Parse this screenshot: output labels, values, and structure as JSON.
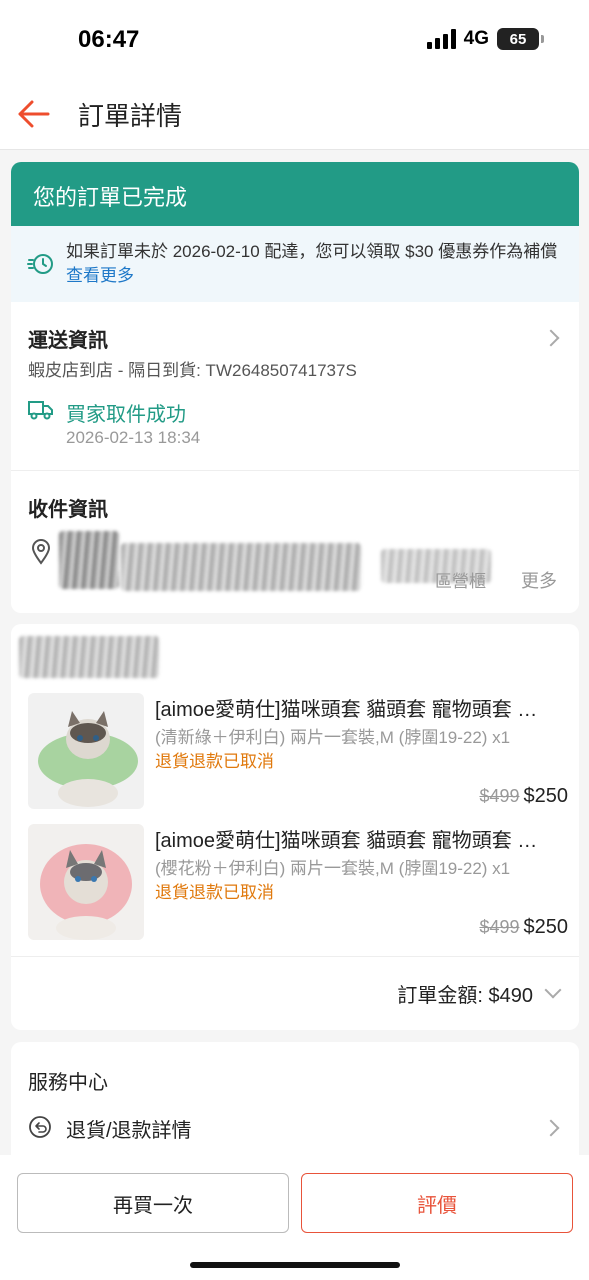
{
  "status_bar": {
    "time": "06:47",
    "network": "4G",
    "battery": "65"
  },
  "nav": {
    "title": "訂單詳情"
  },
  "order_status": {
    "title": "您的訂單已完成",
    "notice_text": "如果訂單未於 2026-02-10 配達，您可以領取 $30 優惠券作為補償",
    "notice_link": "查看更多"
  },
  "shipping": {
    "title": "運送資訊",
    "method": "蝦皮店到店 - 隔日到貨: TW264850741737S",
    "status": "買家取件成功",
    "time": "2026-02-13 18:34"
  },
  "recipient": {
    "title": "收件資訊",
    "partial_text": "區營櫃",
    "more": "更多"
  },
  "products": [
    {
      "name": "[aimoe愛萌仕]猫咪頭套 貓頭套 寵物頭套 伊莉莎白頭套",
      "variant": "(清新綠＋伊利白) 兩片一套裝,M (脖圍19-22) x1",
      "status": "退貨退款已取消",
      "old_price": "$499",
      "price": "$250",
      "collar_color": "#a8d3a0"
    },
    {
      "name": "[aimoe愛萌仕]猫咪頭套 貓頭套 寵物頭套 伊莉莎白頭套",
      "variant": "(櫻花粉＋伊利白) 兩片一套裝,M (脖圍19-22) x1",
      "status": "退貨退款已取消",
      "old_price": "$499",
      "price": "$250",
      "collar_color": "#f0b4b8"
    }
  ],
  "order_total": {
    "label": "訂單金額: $490"
  },
  "service": {
    "title": "服務中心",
    "return_detail": "退貨/退款詳情"
  },
  "actions": {
    "buy_again": "再買一次",
    "rate": "評價"
  },
  "colors": {
    "brand": "#ee4d2d",
    "accent_green": "#229b86",
    "warning": "#e0790d",
    "link": "#1e78c8"
  }
}
